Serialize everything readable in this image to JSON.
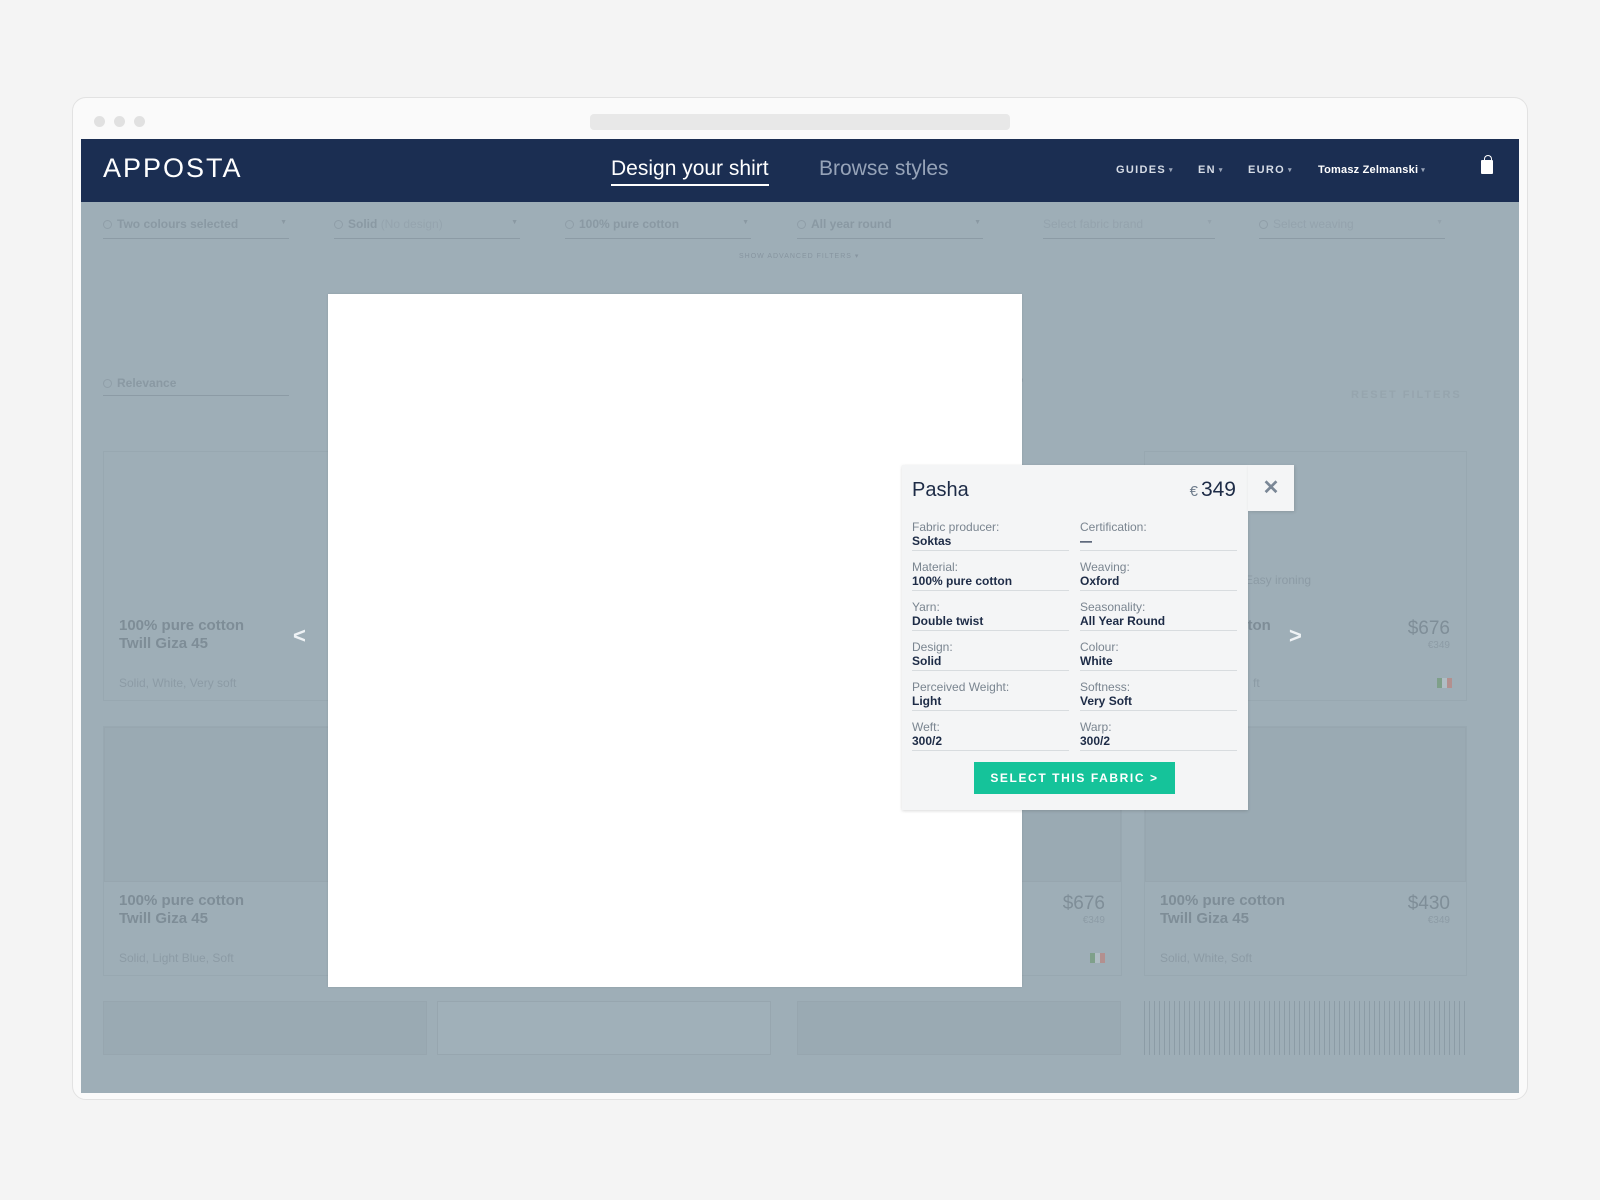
{
  "nav": {
    "logo": "APPOSTA",
    "tab_active": "Design your shirt",
    "tab_inactive": "Browse styles",
    "guides": "GUIDES",
    "language": "EN",
    "currency": "EURO",
    "user": "Tomasz Zelmanski",
    "caret": "▾"
  },
  "filters": [
    {
      "label": "Two colours selected",
      "extra": ""
    },
    {
      "label": "Solid",
      "extra": "(No design)"
    },
    {
      "label": "100% pure cotton",
      "extra": ""
    },
    {
      "label": "All year round",
      "extra": ""
    },
    {
      "label": "Select fabric brand",
      "extra": ""
    },
    {
      "label": "Select weaving",
      "extra": ""
    }
  ],
  "advanced_filters": "SHOW ADVANCED FILTERS ▾",
  "sort": "Relevance",
  "reset_filters": "RESET FILTERS",
  "cards": [
    {
      "title1": "100% pure cotton",
      "title2": "Twill Giza 45",
      "sub": "Solid, White, Very soft"
    },
    {
      "title1": "cotton",
      "title2": "5",
      "sub": "ft",
      "price": "$676",
      "price_small": "€349",
      "note": "Easy ironing"
    },
    {
      "title1": "100% pure cotton",
      "title2": "Twill Giza 45",
      "sub": "Solid, Light Blue, Soft"
    },
    {
      "price": "$676",
      "price_small": "€349"
    },
    {
      "title1": "100% pure cotton",
      "title2": "Twill Giza 45",
      "sub": "Solid, White, Soft",
      "price": "$430",
      "price_small": "€349"
    }
  ],
  "ghost_text": "S,",
  "popup": {
    "name": "Pasha",
    "currency": "€",
    "price": "349",
    "close": "✕",
    "specs": [
      {
        "label": "Fabric producer:",
        "value": "Soktas"
      },
      {
        "label": "Certification:",
        "value": "—"
      },
      {
        "label": "Material:",
        "value": "100% pure cotton"
      },
      {
        "label": "Weaving:",
        "value": "Oxford"
      },
      {
        "label": "Yarn:",
        "value": "Double twist"
      },
      {
        "label": "Seasonality:",
        "value": "All Year Round"
      },
      {
        "label": "Design:",
        "value": "Solid"
      },
      {
        "label": "Colour:",
        "value": "White"
      },
      {
        "label": "Perceived Weight:",
        "value": "Light"
      },
      {
        "label": "Softness:",
        "value": "Very Soft"
      },
      {
        "label": "Weft:",
        "value": "300/2"
      },
      {
        "label": "Warp:",
        "value": "300/2"
      }
    ],
    "select_button": "SELECT THIS FABRIC >"
  },
  "colors": {
    "navbar": "#1b2e52",
    "accent": "#15c39a",
    "overlay": "#9eaeb7"
  }
}
